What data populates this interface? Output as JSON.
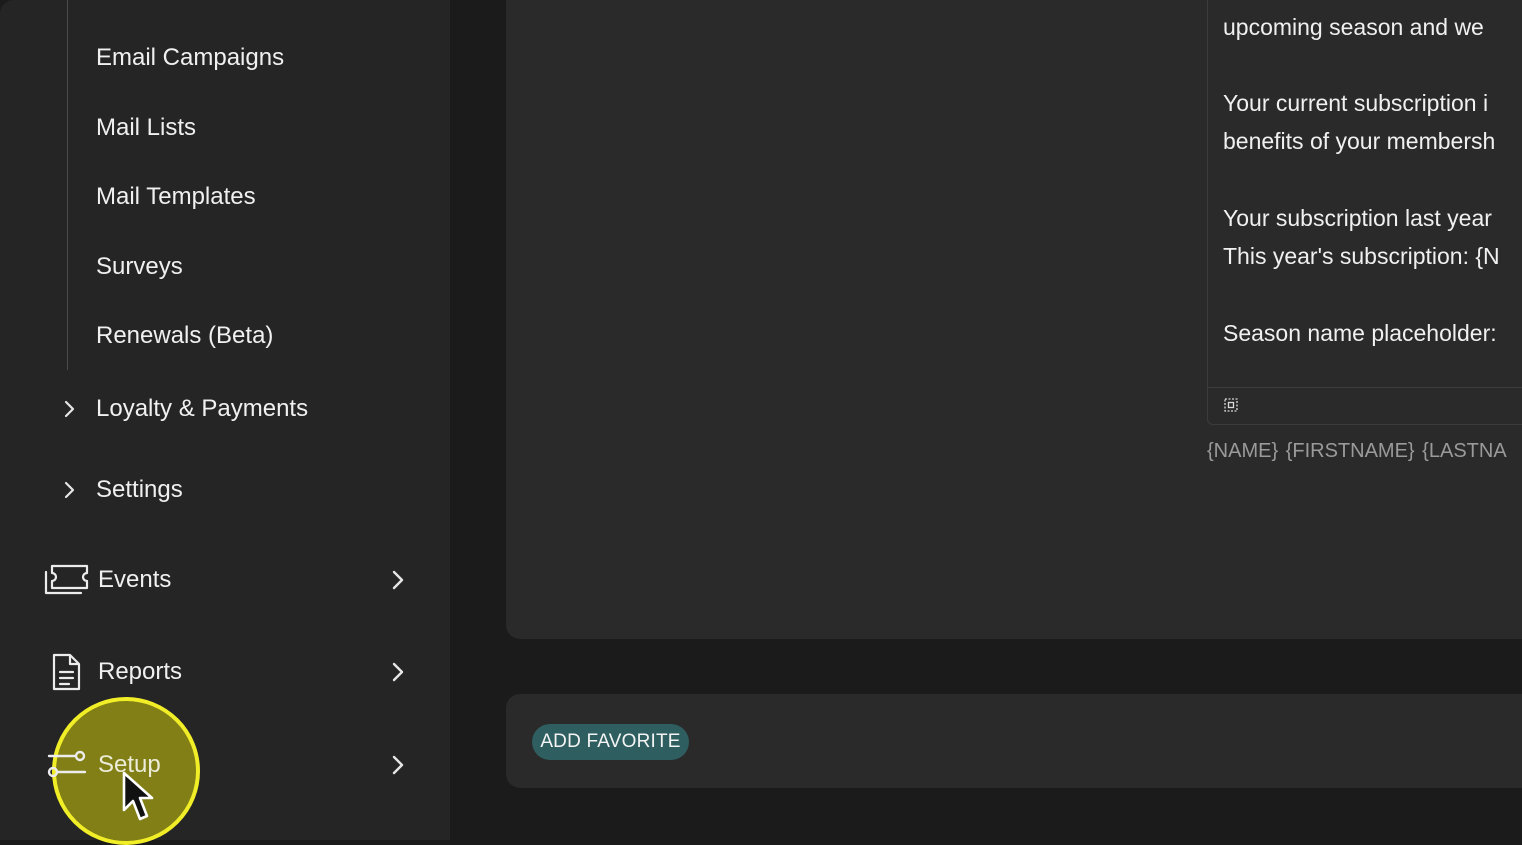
{
  "sidebar": {
    "sub_items": [
      {
        "label": "Email Campaigns"
      },
      {
        "label": "Mail Lists"
      },
      {
        "label": "Mail Templates"
      },
      {
        "label": "Surveys"
      },
      {
        "label": "Renewals (Beta)"
      }
    ],
    "groups": [
      {
        "label": "Loyalty & Payments",
        "icon": "chevron-right-icon"
      },
      {
        "label": "Settings",
        "icon": "chevron-right-icon"
      }
    ],
    "nav": [
      {
        "label": "Events",
        "icon": "ticket-icon"
      },
      {
        "label": "Reports",
        "icon": "document-icon"
      },
      {
        "label": "Setup",
        "icon": "sliders-icon",
        "hovered": true
      }
    ]
  },
  "editor": {
    "lines": [
      "upcoming season and we",
      "Your current subscription i",
      "benefits of your membersh",
      "Your subscription last year",
      "This year's subscription: {N",
      "Season name placeholder:"
    ],
    "placeholders": "{NAME}  {FIRSTNAME} {LASTNA"
  },
  "actions": {
    "add_favorite_label": "ADD FAVORITE"
  },
  "colors": {
    "background": "#1b1b1b",
    "sidebar": "#252525",
    "panel": "#2a2a2a",
    "button": "#2e5e5f",
    "highlight_fill": "#96940f",
    "highlight_ring": "#f1ee27"
  }
}
